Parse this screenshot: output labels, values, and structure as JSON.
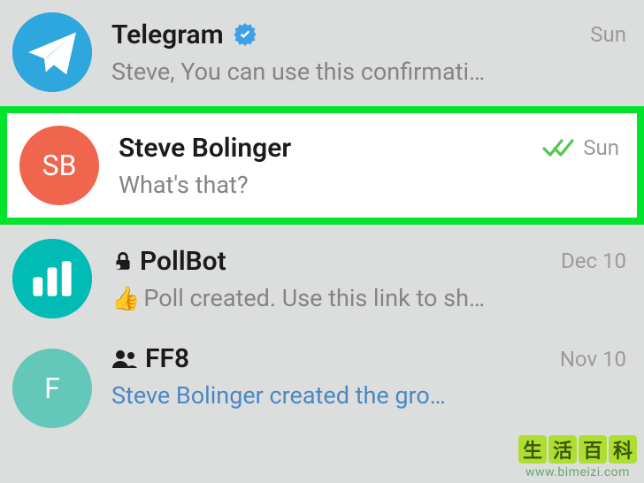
{
  "chats": [
    {
      "title": "Telegram",
      "preview": "Steve,  You can use this confirmati…",
      "time": "Sun",
      "verified": true,
      "avatar": {
        "type": "telegram",
        "bg": "#2ea6de"
      }
    },
    {
      "title": "Steve Bolinger",
      "preview": "What's that?",
      "time": "Sun",
      "read": true,
      "avatar": {
        "type": "initials",
        "text": "SB",
        "bg": "#f0654d"
      }
    },
    {
      "title": "PollBot",
      "preview": "Poll created. Use this link to sh…",
      "time": "Dec 10",
      "secure": true,
      "emoji": "👍",
      "avatar": {
        "type": "bars",
        "bg": "#00bcb4"
      }
    },
    {
      "title": "FF8",
      "preview": "Steve Bolinger created the gro…",
      "time": "Nov 10",
      "group": true,
      "preview_action": true,
      "avatar": {
        "type": "initials",
        "text": "F",
        "bg": "#63c7b9"
      }
    }
  ],
  "watermark": {
    "chars": [
      "生",
      "活",
      "百",
      "科"
    ],
    "url": "www.bimeizi.com"
  }
}
